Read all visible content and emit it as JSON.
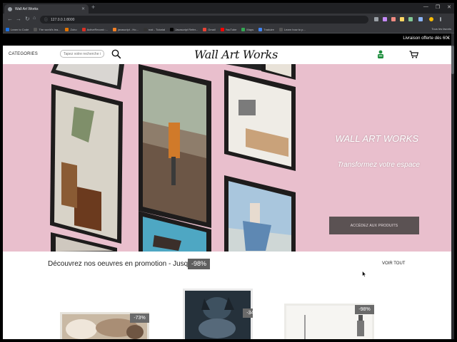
{
  "browser": {
    "tab_title": "Wall Art Works",
    "new_tab_symbol": "+",
    "url": "127.0.0.1:8000",
    "window_controls": [
      "—",
      "❐",
      "✕"
    ],
    "bookmarks": [
      "Learn to Code",
      "The world's lea...",
      "Zoho",
      "ActiveRecord::...",
      "javascript - Ho...",
      "rust - Tutorial",
      "Javascript Refer...",
      "Gmail",
      "YouTube",
      "Maps",
      "Traduire",
      "Learn how to p..."
    ],
    "all_bookmarks": "Tous les favoris"
  },
  "promo_bar": {
    "text": "Livraison offerte dès 60€"
  },
  "header": {
    "categories": "CATEGORIES",
    "search_placeholder": "Tapez votre recherche ici",
    "logo": "Wall Art Works"
  },
  "hero": {
    "title": "WALL ART WORKS",
    "subtitle": "Transformez votre espace",
    "cta_label": "ACCÉDEZ AUX PRODUITS",
    "background_color": "#e9bfcd"
  },
  "promotions": {
    "title": "Découvrez nos oeuvres en promotion - Jusqu'à",
    "max_discount": "-98%",
    "see_all": "VOIR TOUT",
    "products": [
      {
        "discount": "-73%"
      },
      {
        "discount": "-34%"
      },
      {
        "discount": "-98%"
      }
    ]
  }
}
